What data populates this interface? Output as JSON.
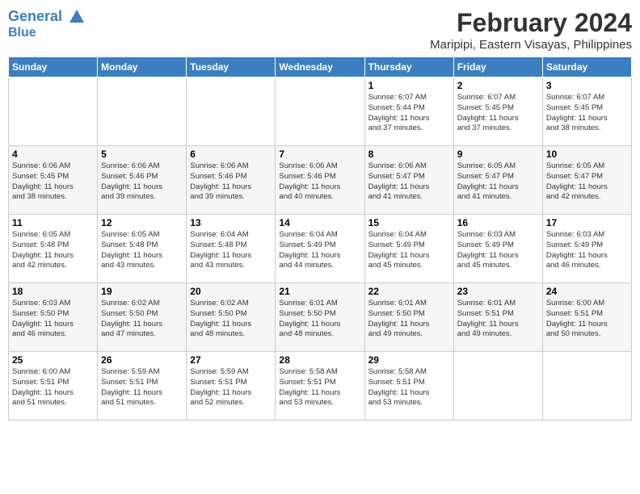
{
  "header": {
    "logo_line1": "General",
    "logo_line2": "Blue",
    "month_year": "February 2024",
    "location": "Maripipi, Eastern Visayas, Philippines"
  },
  "days_of_week": [
    "Sunday",
    "Monday",
    "Tuesday",
    "Wednesday",
    "Thursday",
    "Friday",
    "Saturday"
  ],
  "weeks": [
    [
      {
        "day": "",
        "info": ""
      },
      {
        "day": "",
        "info": ""
      },
      {
        "day": "",
        "info": ""
      },
      {
        "day": "",
        "info": ""
      },
      {
        "day": "1",
        "info": "Sunrise: 6:07 AM\nSunset: 5:44 PM\nDaylight: 11 hours\nand 37 minutes."
      },
      {
        "day": "2",
        "info": "Sunrise: 6:07 AM\nSunset: 5:45 PM\nDaylight: 11 hours\nand 37 minutes."
      },
      {
        "day": "3",
        "info": "Sunrise: 6:07 AM\nSunset: 5:45 PM\nDaylight: 11 hours\nand 38 minutes."
      }
    ],
    [
      {
        "day": "4",
        "info": "Sunrise: 6:06 AM\nSunset: 5:45 PM\nDaylight: 11 hours\nand 38 minutes."
      },
      {
        "day": "5",
        "info": "Sunrise: 6:06 AM\nSunset: 5:46 PM\nDaylight: 11 hours\nand 39 minutes."
      },
      {
        "day": "6",
        "info": "Sunrise: 6:06 AM\nSunset: 5:46 PM\nDaylight: 11 hours\nand 39 minutes."
      },
      {
        "day": "7",
        "info": "Sunrise: 6:06 AM\nSunset: 5:46 PM\nDaylight: 11 hours\nand 40 minutes."
      },
      {
        "day": "8",
        "info": "Sunrise: 6:06 AM\nSunset: 5:47 PM\nDaylight: 11 hours\nand 41 minutes."
      },
      {
        "day": "9",
        "info": "Sunrise: 6:05 AM\nSunset: 5:47 PM\nDaylight: 11 hours\nand 41 minutes."
      },
      {
        "day": "10",
        "info": "Sunrise: 6:05 AM\nSunset: 5:47 PM\nDaylight: 11 hours\nand 42 minutes."
      }
    ],
    [
      {
        "day": "11",
        "info": "Sunrise: 6:05 AM\nSunset: 5:48 PM\nDaylight: 11 hours\nand 42 minutes."
      },
      {
        "day": "12",
        "info": "Sunrise: 6:05 AM\nSunset: 5:48 PM\nDaylight: 11 hours\nand 43 minutes."
      },
      {
        "day": "13",
        "info": "Sunrise: 6:04 AM\nSunset: 5:48 PM\nDaylight: 11 hours\nand 43 minutes."
      },
      {
        "day": "14",
        "info": "Sunrise: 6:04 AM\nSunset: 5:49 PM\nDaylight: 11 hours\nand 44 minutes."
      },
      {
        "day": "15",
        "info": "Sunrise: 6:04 AM\nSunset: 5:49 PM\nDaylight: 11 hours\nand 45 minutes."
      },
      {
        "day": "16",
        "info": "Sunrise: 6:03 AM\nSunset: 5:49 PM\nDaylight: 11 hours\nand 45 minutes."
      },
      {
        "day": "17",
        "info": "Sunrise: 6:03 AM\nSunset: 5:49 PM\nDaylight: 11 hours\nand 46 minutes."
      }
    ],
    [
      {
        "day": "18",
        "info": "Sunrise: 6:03 AM\nSunset: 5:50 PM\nDaylight: 11 hours\nand 46 minutes."
      },
      {
        "day": "19",
        "info": "Sunrise: 6:02 AM\nSunset: 5:50 PM\nDaylight: 11 hours\nand 47 minutes."
      },
      {
        "day": "20",
        "info": "Sunrise: 6:02 AM\nSunset: 5:50 PM\nDaylight: 11 hours\nand 48 minutes."
      },
      {
        "day": "21",
        "info": "Sunrise: 6:01 AM\nSunset: 5:50 PM\nDaylight: 11 hours\nand 48 minutes."
      },
      {
        "day": "22",
        "info": "Sunrise: 6:01 AM\nSunset: 5:50 PM\nDaylight: 11 hours\nand 49 minutes."
      },
      {
        "day": "23",
        "info": "Sunrise: 6:01 AM\nSunset: 5:51 PM\nDaylight: 11 hours\nand 49 minutes."
      },
      {
        "day": "24",
        "info": "Sunrise: 6:00 AM\nSunset: 5:51 PM\nDaylight: 11 hours\nand 50 minutes."
      }
    ],
    [
      {
        "day": "25",
        "info": "Sunrise: 6:00 AM\nSunset: 5:51 PM\nDaylight: 11 hours\nand 51 minutes."
      },
      {
        "day": "26",
        "info": "Sunrise: 5:59 AM\nSunset: 5:51 PM\nDaylight: 11 hours\nand 51 minutes."
      },
      {
        "day": "27",
        "info": "Sunrise: 5:59 AM\nSunset: 5:51 PM\nDaylight: 11 hours\nand 52 minutes."
      },
      {
        "day": "28",
        "info": "Sunrise: 5:58 AM\nSunset: 5:51 PM\nDaylight: 11 hours\nand 53 minutes."
      },
      {
        "day": "29",
        "info": "Sunrise: 5:58 AM\nSunset: 5:51 PM\nDaylight: 11 hours\nand 53 minutes."
      },
      {
        "day": "",
        "info": ""
      },
      {
        "day": "",
        "info": ""
      }
    ]
  ]
}
